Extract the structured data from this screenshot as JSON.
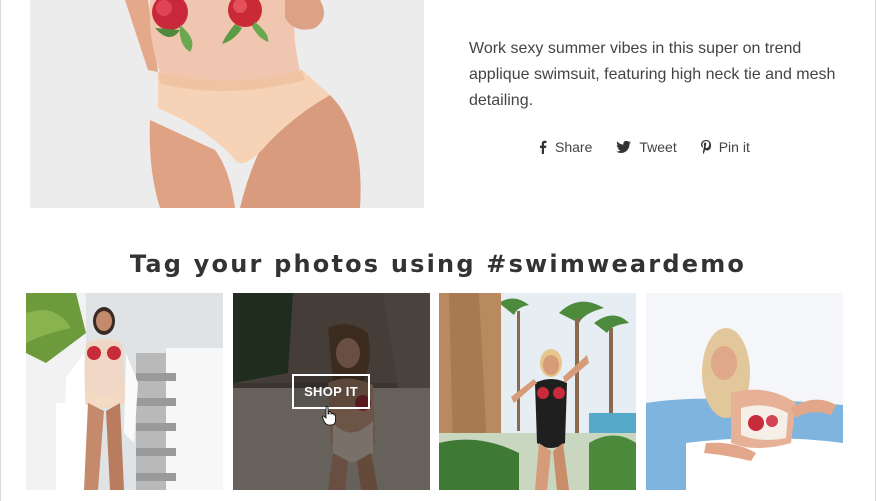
{
  "product": {
    "description": "Work sexy summer vibes in this super on trend applique swimsuit, featuring high neck tie and mesh detailing."
  },
  "share": {
    "items": [
      {
        "label": "Share",
        "icon": "facebook-icon"
      },
      {
        "label": "Tweet",
        "icon": "twitter-icon"
      },
      {
        "label": "Pin it",
        "icon": "pinterest-icon"
      }
    ]
  },
  "instagram": {
    "title": "Tag your photos using #swimweardemo",
    "shop_label": "SHOP IT"
  },
  "colors": {
    "text": "#444444",
    "heading": "#333333",
    "border": "#d9d9d9",
    "overlay": "#141414"
  }
}
